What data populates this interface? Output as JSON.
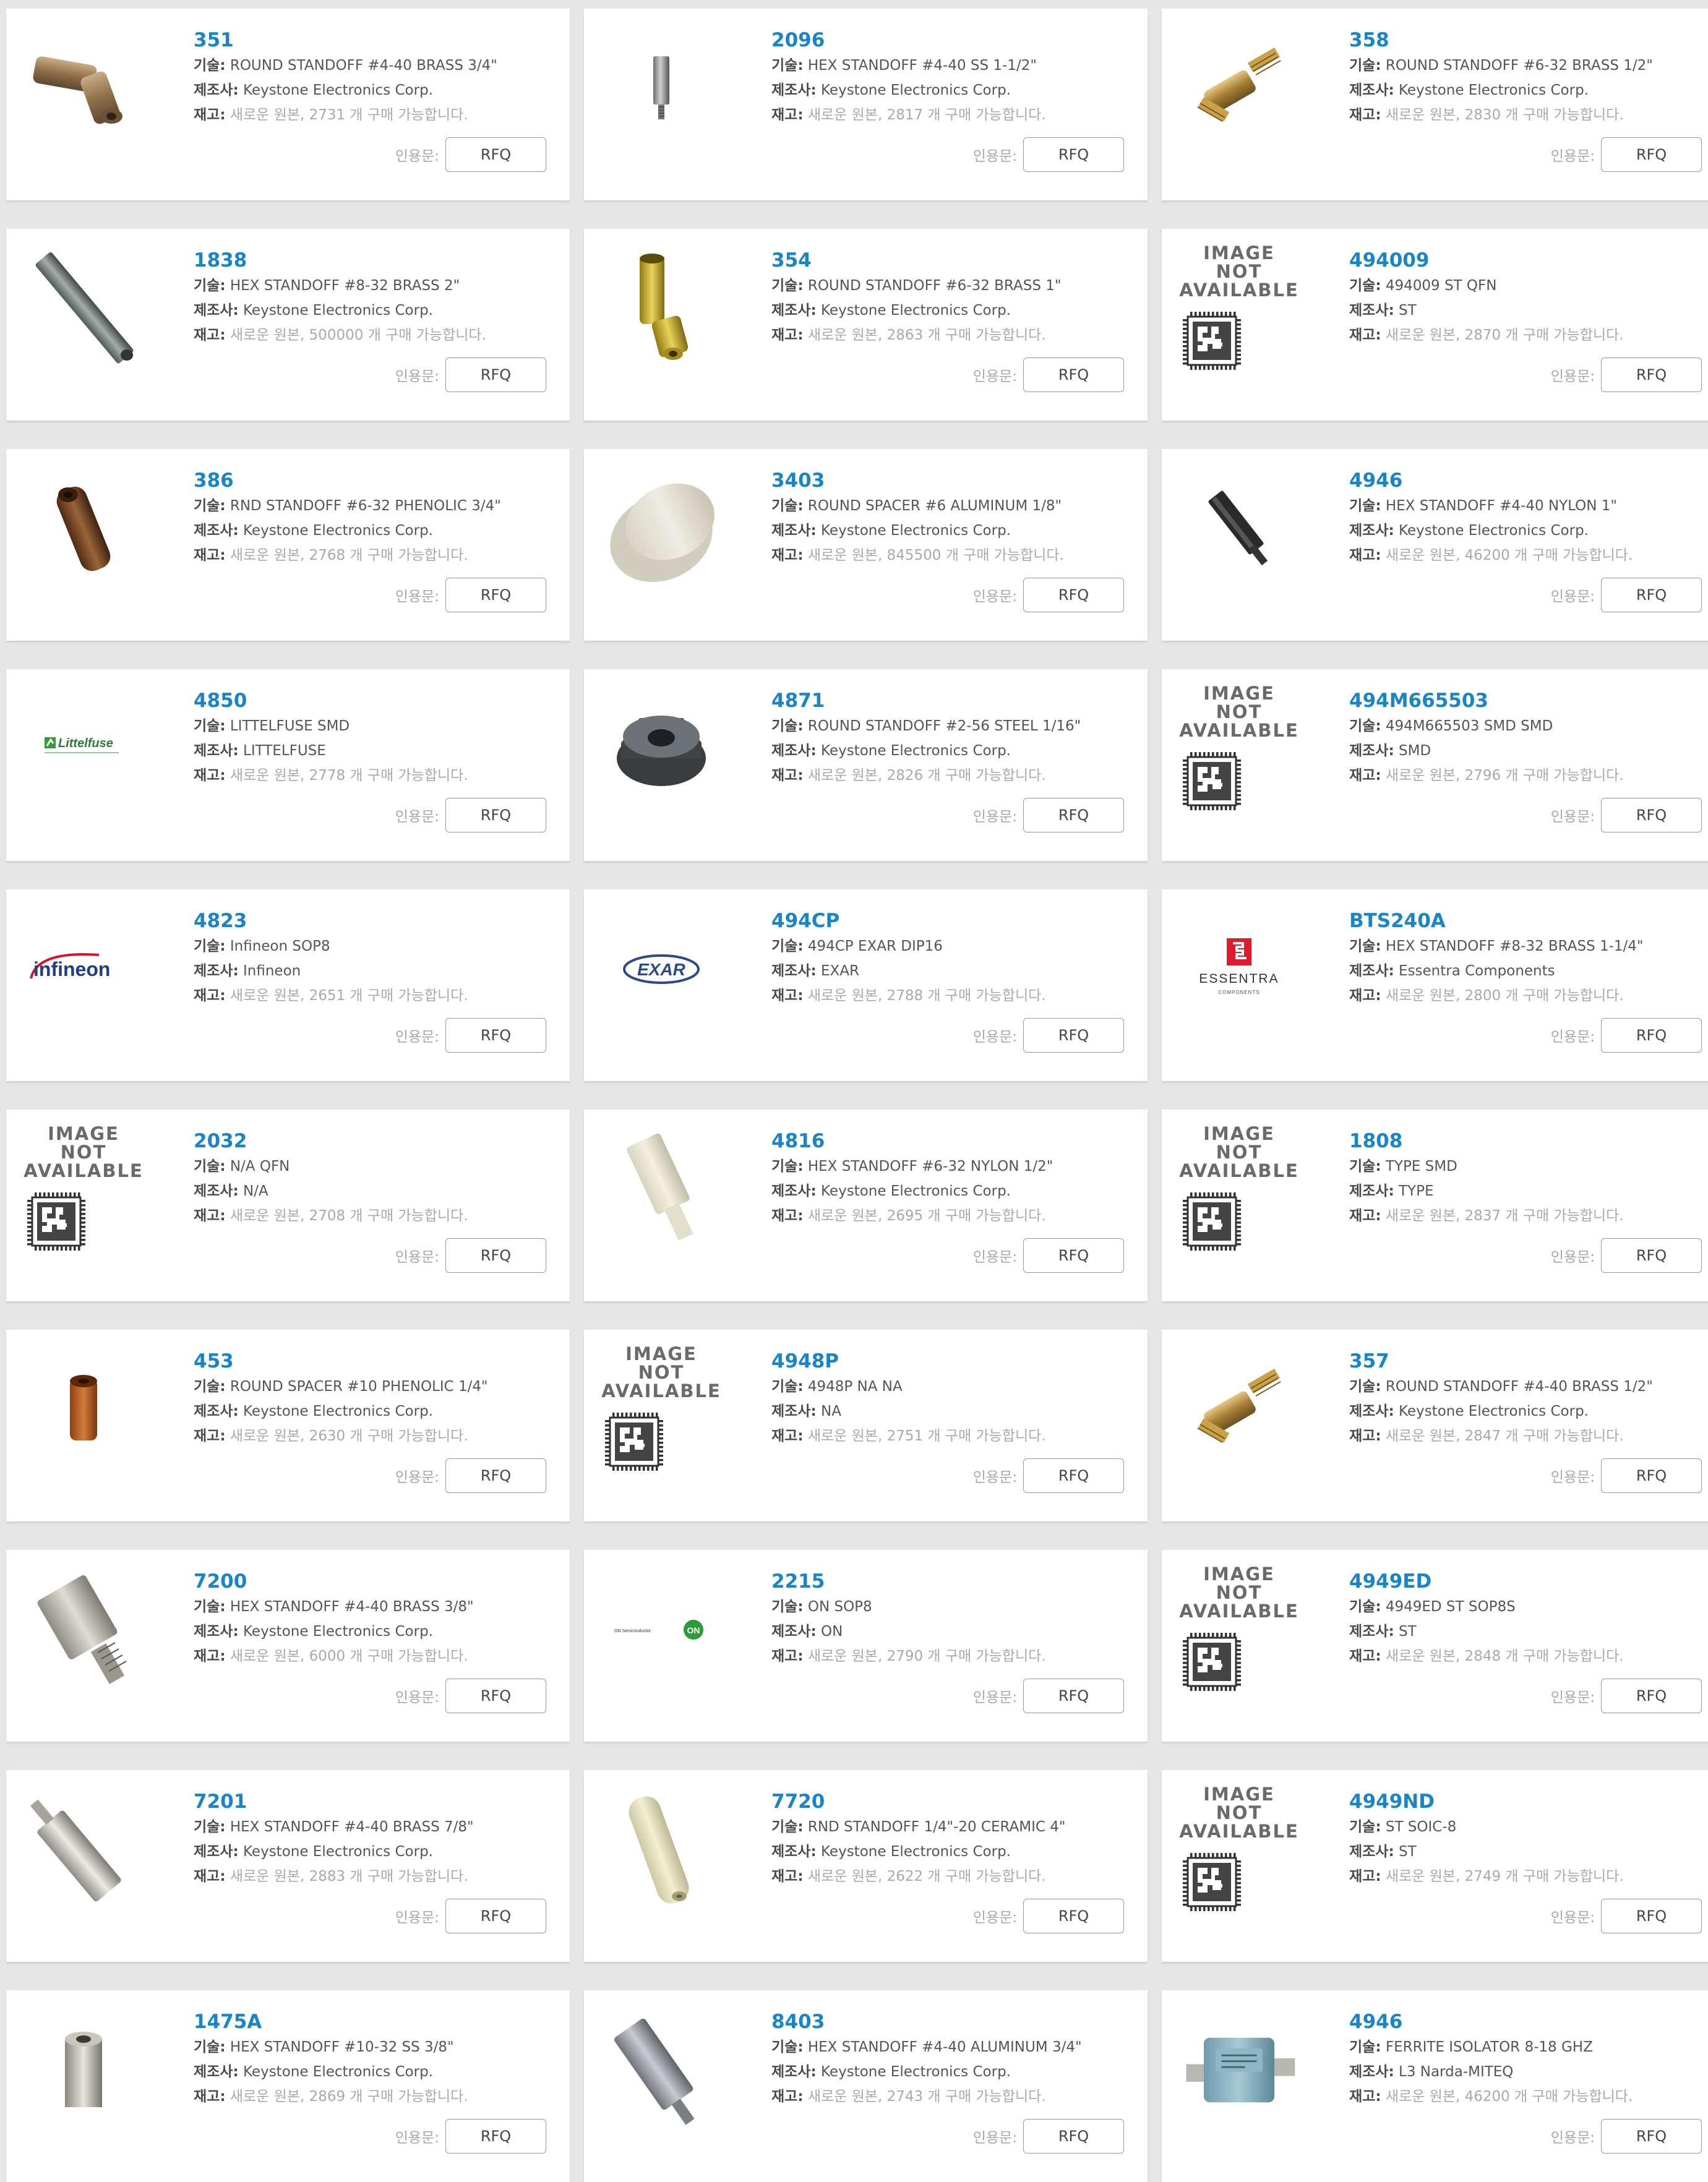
{
  "labels": {
    "desc": "기술:",
    "mfr": "제조사:",
    "stock": "재고:",
    "quote": "인용문:",
    "rfq": "RFQ",
    "image_not_available_line1": "IMAGE NOT",
    "image_not_available_line2": "AVAILABLE"
  },
  "products": [
    {
      "pn": "351",
      "desc": "ROUND STANDOFF #4-40 BRASS 3/4\"",
      "mfr": "Keystone Electronics Corp.",
      "stock": "새로운 원본, 2731 개 구매 가능합니다.",
      "image": "brass-swivel-standoff"
    },
    {
      "pn": "2096",
      "desc": "HEX STANDOFF #4-40 SS 1-1/2\"",
      "mfr": "Keystone Electronics Corp.",
      "stock": "새로운 원본, 2817 개 구매 가능합니다.",
      "image": "small-steel-standoff"
    },
    {
      "pn": "358",
      "desc": "ROUND STANDOFF #6-32 BRASS 1/2\"",
      "mfr": "Keystone Electronics Corp.",
      "stock": "새로운 원본, 2830 개 구매 가능합니다.",
      "image": "brass-threaded-standoff"
    },
    {
      "pn": "1838",
      "desc": "HEX STANDOFF #8-32 BRASS 2\"",
      "mfr": "Keystone Electronics Corp.",
      "stock": "새로운 원본, 500000 개 구매 가능합니다.",
      "image": "long-gray-hex-standoff"
    },
    {
      "pn": "354",
      "desc": "ROUND STANDOFF #6-32 BRASS 1\"",
      "mfr": "Keystone Electronics Corp.",
      "stock": "새로운 원본, 2863 개 구매 가능합니다.",
      "image": "gold-brass-standoff"
    },
    {
      "pn": "494009",
      "desc": "494009 ST QFN",
      "mfr": "ST",
      "stock": "새로운 원본, 2870 개 구매 가능합니다.",
      "image": "image-not-available"
    },
    {
      "pn": "386",
      "desc": "RND STANDOFF #6-32 PHENOLIC 3/4\"",
      "mfr": "Keystone Electronics Corp.",
      "stock": "새로운 원본, 2768 개 구매 가능합니다.",
      "image": "brown-phenolic-standoff"
    },
    {
      "pn": "3403",
      "desc": "ROUND SPACER #6 ALUMINUM 1/8\"",
      "mfr": "Keystone Electronics Corp.",
      "stock": "새로운 원본, 845500 개 구매 가능합니다.",
      "image": "round-aluminum-spacer"
    },
    {
      "pn": "4946",
      "desc": "HEX STANDOFF #4-40 NYLON 1\"",
      "mfr": "Keystone Electronics Corp.",
      "stock": "새로운 원본, 46200 개 구매 가능합니다.",
      "image": "black-nylon-standoff"
    },
    {
      "pn": "4850",
      "desc": "LITTELFUSE SMD",
      "mfr": "LITTELFUSE",
      "stock": "새로운 원본, 2778 개 구매 가능합니다.",
      "image": "littelfuse-logo",
      "logo_text": "Littelfuse"
    },
    {
      "pn": "4871",
      "desc": "ROUND STANDOFF #2-56 STEEL 1/16\"",
      "mfr": "Keystone Electronics Corp.",
      "stock": "새로운 원본, 2826 개 구매 가능합니다.",
      "image": "steel-nut"
    },
    {
      "pn": "494M665503",
      "desc": "494M665503 SMD SMD",
      "mfr": "SMD",
      "stock": "새로운 원본, 2796 개 구매 가능합니다.",
      "image": "image-not-available"
    },
    {
      "pn": "4823",
      "desc": "Infineon SOP8",
      "mfr": "Infineon",
      "stock": "새로운 원본, 2651 개 구매 가능합니다.",
      "image": "infineon-logo",
      "logo_text": "infineon"
    },
    {
      "pn": "494CP",
      "desc": "494CP EXAR DIP16",
      "mfr": "EXAR",
      "stock": "새로운 원본, 2788 개 구매 가능합니다.",
      "image": "exar-logo",
      "logo_text": "EXAR"
    },
    {
      "pn": "BTS240A",
      "desc": "HEX STANDOFF #8-32 BRASS 1-1/4\"",
      "mfr": "Essentra Components",
      "stock": "새로운 원본, 2800 개 구매 가능합니다.",
      "image": "essentra-logo",
      "logo_text": "ESSENTRA",
      "logo_sub": "COMPONENTS"
    },
    {
      "pn": "2032",
      "desc": "N/A QFN",
      "mfr": "N/A",
      "stock": "새로운 원본, 2708 개 구매 가능합니다.",
      "image": "image-not-available"
    },
    {
      "pn": "4816",
      "desc": "HEX STANDOFF #6-32 NYLON 1/2\"",
      "mfr": "Keystone Electronics Corp.",
      "stock": "새로운 원본, 2695 개 구매 가능합니다.",
      "image": "white-nylon-standoff"
    },
    {
      "pn": "1808",
      "desc": "TYPE SMD",
      "mfr": "TYPE",
      "stock": "새로운 원본, 2837 개 구매 가능합니다.",
      "image": "image-not-available"
    },
    {
      "pn": "453",
      "desc": "ROUND SPACER #10 PHENOLIC 1/4\"",
      "mfr": "Keystone Electronics Corp.",
      "stock": "새로운 원본, 2630 개 구매 가능합니다.",
      "image": "orange-phenolic-spacer"
    },
    {
      "pn": "4948P",
      "desc": "4948P NA NA",
      "mfr": "NA",
      "stock": "새로운 원본, 2751 개 구매 가능합니다.",
      "image": "image-not-available"
    },
    {
      "pn": "357",
      "desc": "ROUND STANDOFF #4-40 BRASS 1/2\"",
      "mfr": "Keystone Electronics Corp.",
      "stock": "새로운 원본, 2847 개 구매 가능합니다.",
      "image": "brass-threaded-standoff"
    },
    {
      "pn": "7200",
      "desc": "HEX STANDOFF #4-40 BRASS 3/8\"",
      "mfr": "Keystone Electronics Corp.",
      "stock": "새로운 원본, 6000 개 구매 가능합니다.",
      "image": "short-hex-standoff"
    },
    {
      "pn": "2215",
      "desc": "ON SOP8",
      "mfr": "ON",
      "stock": "새로운 원본, 2790 개 구매 가능합니다.",
      "image": "on-semi-logo",
      "logo_text": "ON Semiconductor",
      "logo_badge": "ON"
    },
    {
      "pn": "4949ED",
      "desc": "4949ED ST SOP8S",
      "mfr": "ST",
      "stock": "새로운 원본, 2848 개 구매 가능합니다.",
      "image": "image-not-available"
    },
    {
      "pn": "7201",
      "desc": "HEX STANDOFF #4-40 BRASS 7/8\"",
      "mfr": "Keystone Electronics Corp.",
      "stock": "새로운 원본, 2883 개 구매 가능합니다.",
      "image": "silver-hex-standoff"
    },
    {
      "pn": "7720",
      "desc": "RND STANDOFF 1/4\"-20 CERAMIC 4\"",
      "mfr": "Keystone Electronics Corp.",
      "stock": "새로운 원본, 2622 개 구매 가능합니다.",
      "image": "ceramic-standoff"
    },
    {
      "pn": "4949ND",
      "desc": "ST SOIC-8",
      "mfr": "ST",
      "stock": "새로운 원본, 2749 개 구매 가능합니다.",
      "image": "image-not-available"
    },
    {
      "pn": "1475A",
      "desc": "HEX STANDOFF #10-32 SS 3/8\"",
      "mfr": "Keystone Electronics Corp.",
      "stock": "새로운 원본, 2869 개 구매 가능합니다.",
      "image": "small-hex-coupler"
    },
    {
      "pn": "8403",
      "desc": "HEX STANDOFF #4-40 ALUMINUM 3/4\"",
      "mfr": "Keystone Electronics Corp.",
      "stock": "새로운 원본, 2743 개 구매 가능합니다.",
      "image": "aluminum-hex-standoff"
    },
    {
      "pn": "4946",
      "desc": "FERRITE ISOLATOR 8-18 GHZ",
      "mfr": "L3 Narda-MITEQ",
      "stock": "새로운 원본, 46200 개 구매 가능합니다.",
      "image": "ferrite-isolator"
    }
  ]
}
